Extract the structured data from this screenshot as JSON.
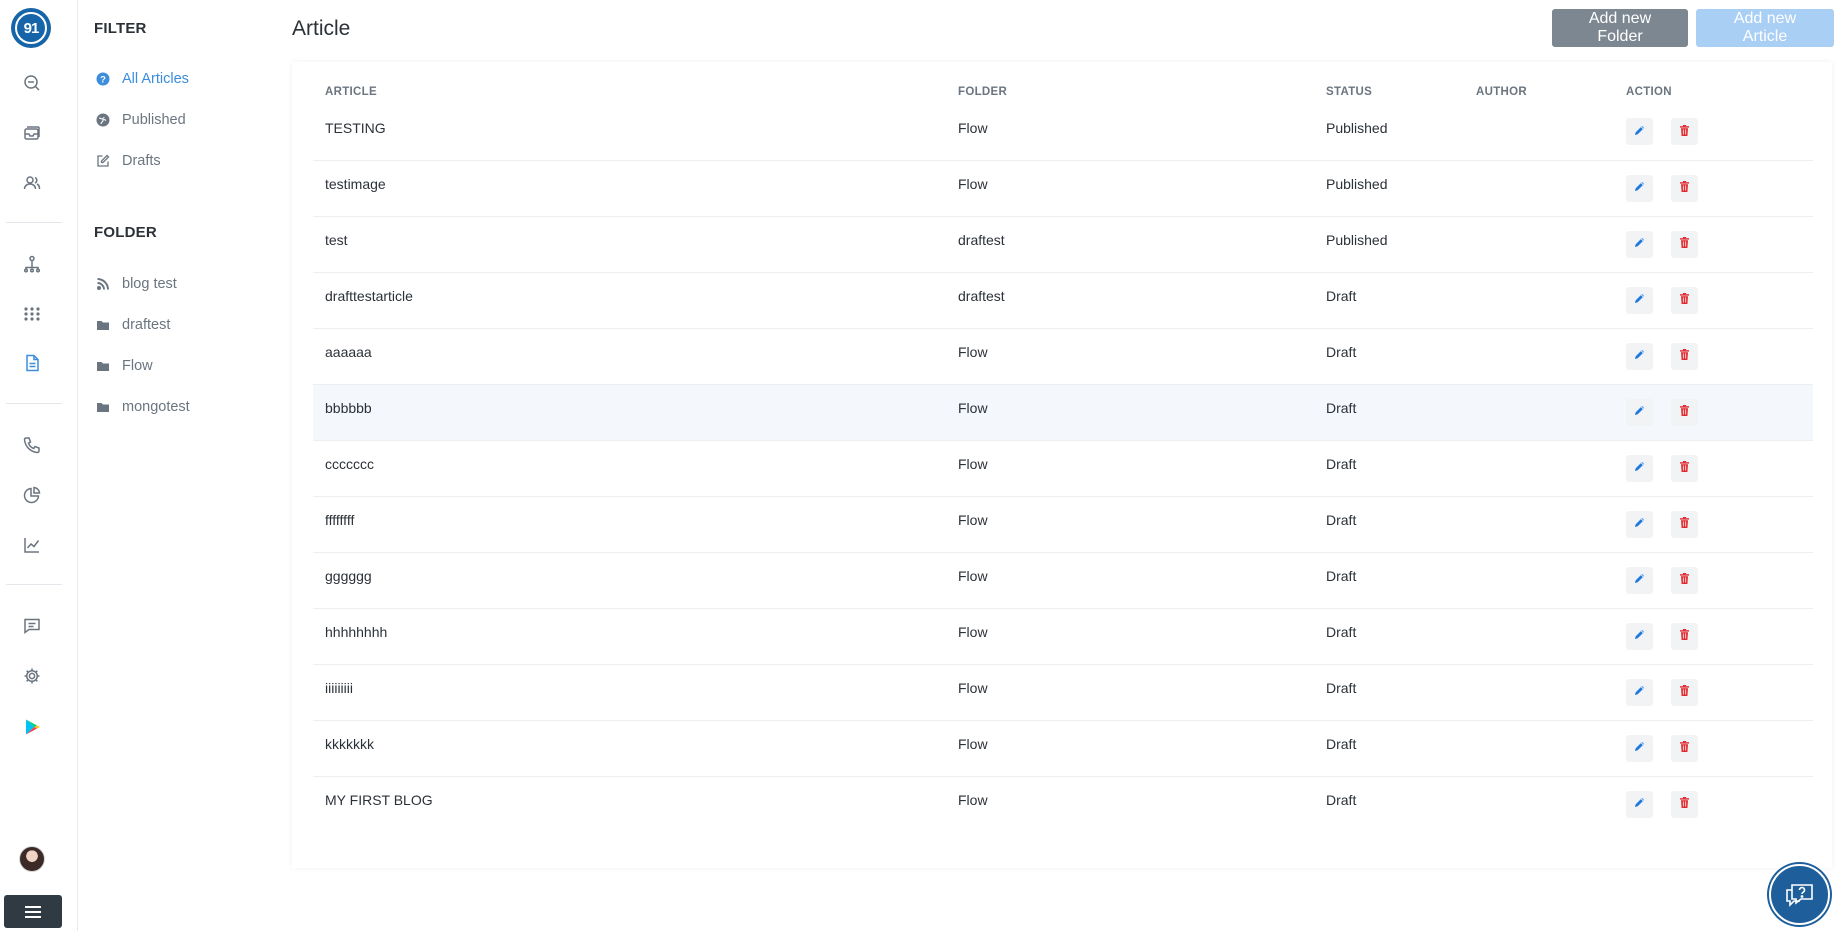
{
  "rail": {
    "logo_text": "91",
    "icons": [
      "chat-search-icon",
      "inbox-stack-icon",
      "users-icon",
      "hierarchy-icon",
      "apps-grid-icon",
      "document-icon",
      "phone-icon",
      "pie-chart-icon",
      "line-chart-icon",
      "message-icon",
      "gear-icon",
      "play-store-icon"
    ]
  },
  "filter": {
    "heading": "FILTER",
    "items": [
      {
        "label": "All Articles",
        "icon": "question-circle-icon",
        "active": true
      },
      {
        "label": "Published",
        "icon": "globe-icon",
        "active": false
      },
      {
        "label": "Drafts",
        "icon": "edit-icon",
        "active": false
      }
    ]
  },
  "folder": {
    "heading": "FOLDER",
    "items": [
      {
        "label": "blog test",
        "icon": "rss-icon"
      },
      {
        "label": "draftest",
        "icon": "folder-icon"
      },
      {
        "label": "Flow",
        "icon": "folder-icon"
      },
      {
        "label": "mongotest",
        "icon": "folder-icon"
      }
    ]
  },
  "header": {
    "title": "Article",
    "add_folder_label": "Add new Folder",
    "add_article_label": "Add new Article"
  },
  "table": {
    "columns": [
      "ARTICLE",
      "FOLDER",
      "STATUS",
      "AUTHOR",
      "ACTION"
    ],
    "rows": [
      {
        "article": "TESTING",
        "folder": "Flow",
        "status": "Published",
        "author": ""
      },
      {
        "article": "testimage",
        "folder": "Flow",
        "status": "Published",
        "author": ""
      },
      {
        "article": "test",
        "folder": "draftest",
        "status": "Published",
        "author": ""
      },
      {
        "article": "drafttestarticle",
        "folder": "draftest",
        "status": "Draft",
        "author": ""
      },
      {
        "article": "aaaaaa",
        "folder": "Flow",
        "status": "Draft",
        "author": ""
      },
      {
        "article": "bbbbbb",
        "folder": "Flow",
        "status": "Draft",
        "author": ""
      },
      {
        "article": "ccccccc",
        "folder": "Flow",
        "status": "Draft",
        "author": ""
      },
      {
        "article": "ffffffff",
        "folder": "Flow",
        "status": "Draft",
        "author": ""
      },
      {
        "article": "gggggg",
        "folder": "Flow",
        "status": "Draft",
        "author": ""
      },
      {
        "article": "hhhhhhhh",
        "folder": "Flow",
        "status": "Draft",
        "author": ""
      },
      {
        "article": "iiiiiiiii",
        "folder": "Flow",
        "status": "Draft",
        "author": ""
      },
      {
        "article": "kkkkkkk",
        "folder": "Flow",
        "status": "Draft",
        "author": ""
      },
      {
        "article": "MY FIRST BLOG",
        "folder": "Flow",
        "status": "Draft",
        "author": ""
      }
    ]
  },
  "colors": {
    "accent": "#3c8ddc",
    "edit": "#1f7ae0",
    "delete": "#e0282e",
    "brand": "#1565a8"
  }
}
